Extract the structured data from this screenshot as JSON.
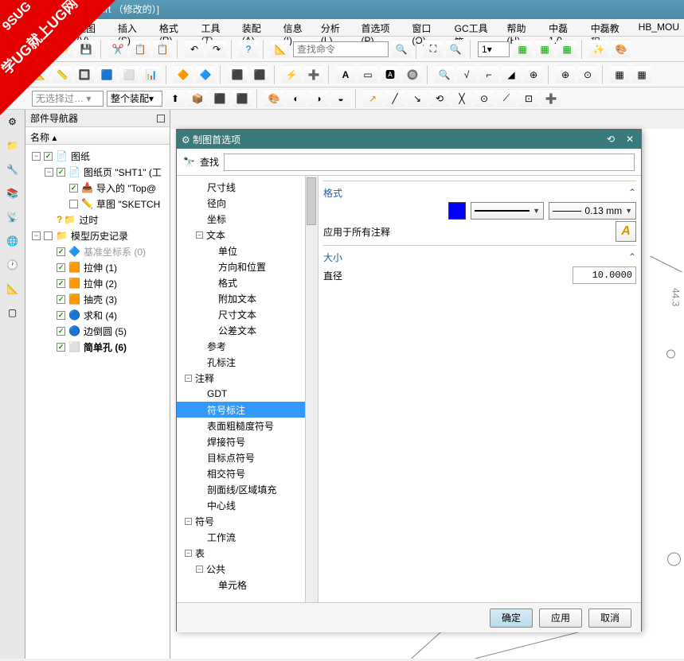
{
  "title": "- [学UG就上UG网 - 7.prt （修改的）]",
  "watermark": {
    "line1": "9SUG",
    "line2": "学UG就上UG网"
  },
  "menus": [
    "视图(V)",
    "插入(S)",
    "格式(R)",
    "工具(T)",
    "装配(A)",
    "信息(I)",
    "分析(L)",
    "首选项(P)",
    "窗口(O)",
    "GC工具箱",
    "帮助(H)",
    "中磊1.0",
    "中磊教程",
    "HB_MOU"
  ],
  "search_placeholder": "查找命令",
  "assembly_dropdown": "整个装配",
  "dropdown1": "1",
  "navigator": {
    "title": "部件导航器",
    "col": "名称",
    "items": [
      {
        "ind": 0,
        "exp": "-",
        "chk": true,
        "icon": "📄",
        "label": "图纸"
      },
      {
        "ind": 1,
        "exp": "-",
        "chk": true,
        "icon": "📄",
        "label": "图纸页 \"SHT1\" (工"
      },
      {
        "ind": 2,
        "exp": "",
        "chk": true,
        "icon": "📥",
        "label": "导入的 \"Top@"
      },
      {
        "ind": 2,
        "exp": "",
        "chk": false,
        "icon": "✏️",
        "label": "草图 \"SKETCH"
      },
      {
        "ind": 1,
        "exp": "",
        "chk": false,
        "icon": "📁",
        "label": "过时",
        "q": true
      },
      {
        "ind": 0,
        "exp": "-",
        "chk": false,
        "icon": "📁",
        "label": "模型历史记录"
      },
      {
        "ind": 1,
        "exp": "",
        "chk": true,
        "icon": "🔷",
        "label": "基准坐标系 (0)",
        "grey": true
      },
      {
        "ind": 1,
        "exp": "",
        "chk": true,
        "icon": "🟧",
        "label": "拉伸 (1)"
      },
      {
        "ind": 1,
        "exp": "",
        "chk": true,
        "icon": "🟧",
        "label": "拉伸 (2)"
      },
      {
        "ind": 1,
        "exp": "",
        "chk": true,
        "icon": "🟧",
        "label": "抽壳 (3)"
      },
      {
        "ind": 1,
        "exp": "",
        "chk": true,
        "icon": "🔵",
        "label": "求和 (4)"
      },
      {
        "ind": 1,
        "exp": "",
        "chk": true,
        "icon": "🔵",
        "label": "边倒圆 (5)"
      },
      {
        "ind": 1,
        "exp": "",
        "chk": true,
        "icon": "⬜",
        "label": "简单孔 (6)",
        "bold": true
      }
    ]
  },
  "dialog": {
    "title": "制图首选项",
    "search_label": "查找",
    "tree": [
      {
        "ind": 2,
        "label": "尺寸线"
      },
      {
        "ind": 2,
        "label": "径向"
      },
      {
        "ind": 2,
        "label": "坐标"
      },
      {
        "ind": 1,
        "exp": "-",
        "label": "文本"
      },
      {
        "ind": 3,
        "label": "单位"
      },
      {
        "ind": 3,
        "label": "方向和位置"
      },
      {
        "ind": 3,
        "label": "格式"
      },
      {
        "ind": 3,
        "label": "附加文本"
      },
      {
        "ind": 3,
        "label": "尺寸文本"
      },
      {
        "ind": 3,
        "label": "公差文本"
      },
      {
        "ind": 2,
        "label": "参考"
      },
      {
        "ind": 2,
        "label": "孔标注"
      },
      {
        "ind": 0,
        "exp": "-",
        "label": "注释"
      },
      {
        "ind": 2,
        "label": "GDT"
      },
      {
        "ind": 2,
        "label": "符号标注",
        "sel": true
      },
      {
        "ind": 2,
        "label": "表面粗糙度符号"
      },
      {
        "ind": 2,
        "label": "焊接符号"
      },
      {
        "ind": 2,
        "label": "目标点符号"
      },
      {
        "ind": 2,
        "label": "相交符号"
      },
      {
        "ind": 2,
        "label": "剖面线/区域填充"
      },
      {
        "ind": 2,
        "label": "中心线"
      },
      {
        "ind": 0,
        "exp": "-",
        "label": "符号"
      },
      {
        "ind": 2,
        "label": "工作流"
      },
      {
        "ind": 0,
        "exp": "-",
        "label": "表"
      },
      {
        "ind": 1,
        "exp": "-",
        "label": "公共"
      },
      {
        "ind": 3,
        "label": "单元格"
      }
    ],
    "sec_format": "格式",
    "line_width": "0.13 mm",
    "apply_all": "应用于所有注释",
    "sec_size": "大小",
    "diameter": "直径",
    "diameter_val": "10.0000",
    "ok": "确定",
    "apply": "应用",
    "cancel": "取消"
  }
}
